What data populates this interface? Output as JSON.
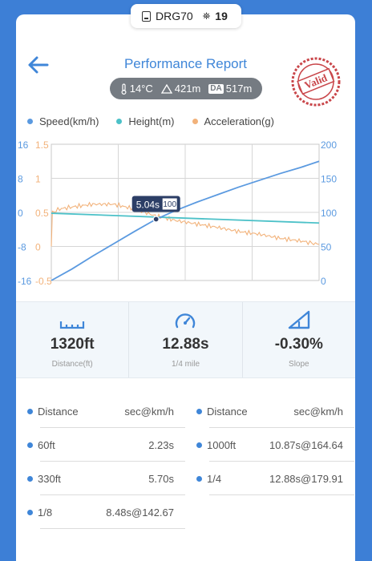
{
  "device": {
    "name": "DRG70",
    "satellite_count": "19"
  },
  "header": {
    "title": "Performance Report",
    "stamp_text": "Valid"
  },
  "conditions": {
    "temperature": "14°C",
    "altitude": "421m",
    "density_altitude_label": "DA",
    "density_altitude": "517m"
  },
  "legend": [
    {
      "label": "Speed(km/h)",
      "color": "#5b9ae0"
    },
    {
      "label": "Height(m)",
      "color": "#4cc1c8"
    },
    {
      "label": "Acceleration(g)",
      "color": "#f2b27a"
    }
  ],
  "chart_data": {
    "type": "line",
    "x_range": [
      0,
      12.88
    ],
    "axes": {
      "height_ticks": [
        "16",
        "8",
        "0",
        "-8",
        "-16"
      ],
      "accel_ticks": [
        "1.5",
        "1",
        "0.5",
        "0",
        "-0.5"
      ],
      "speed_ticks": [
        "200",
        "150",
        "100",
        "50",
        "0"
      ],
      "height_range": [
        -16,
        16
      ],
      "accel_range": [
        -0.5,
        1.5
      ],
      "speed_range": [
        0,
        200
      ]
    },
    "series": [
      {
        "name": "Speed(km/h)",
        "axis": "speed",
        "color": "#5b9ae0",
        "x": [
          0,
          1,
          2,
          3,
          4,
          5.04,
          6,
          7,
          8,
          9,
          10,
          11,
          12,
          12.88
        ],
        "y": [
          0,
          17,
          36,
          54,
          72,
          90,
          103,
          115,
          126,
          137,
          147,
          157,
          166,
          175
        ]
      },
      {
        "name": "Height(m)",
        "axis": "height",
        "color": "#4cc1c8",
        "x": [
          0,
          12.88
        ],
        "y": [
          -0.2,
          -2.5
        ]
      },
      {
        "name": "Acceleration(g)",
        "axis": "accel",
        "color": "#f2b27a",
        "x": [
          0,
          0.05,
          0.4,
          1,
          2,
          3,
          4,
          5,
          6,
          7,
          8,
          9,
          10,
          11,
          12,
          12.88
        ],
        "y": [
          0,
          0.5,
          0.55,
          0.58,
          0.62,
          0.62,
          0.55,
          0.45,
          0.38,
          0.33,
          0.28,
          0.22,
          0.18,
          0.12,
          0.08,
          0.03
        ]
      }
    ],
    "tooltip": {
      "time": "5.04s",
      "value": "100",
      "x": 5.04
    },
    "grid": true
  },
  "stats": [
    {
      "value": "1320ft",
      "label": "Distance(ft)",
      "icon": "ruler-icon"
    },
    {
      "value": "12.88s",
      "label": "1/4 mile",
      "icon": "speedometer-icon"
    },
    {
      "value": "-0.30%",
      "label": "Slope",
      "icon": "slope-icon"
    }
  ],
  "table": {
    "left": [
      {
        "name": "Distance",
        "value": "sec@km/h"
      },
      {
        "name": "60ft",
        "value": "2.23s"
      },
      {
        "name": "330ft",
        "value": "5.70s"
      },
      {
        "name": "1/8",
        "value": "8.48s@142.67"
      }
    ],
    "right": [
      {
        "name": "Distance",
        "value": "sec@km/h"
      },
      {
        "name": "1000ft",
        "value": "10.87s@164.64"
      },
      {
        "name": "1/4",
        "value": "12.88s@179.91"
      }
    ]
  }
}
